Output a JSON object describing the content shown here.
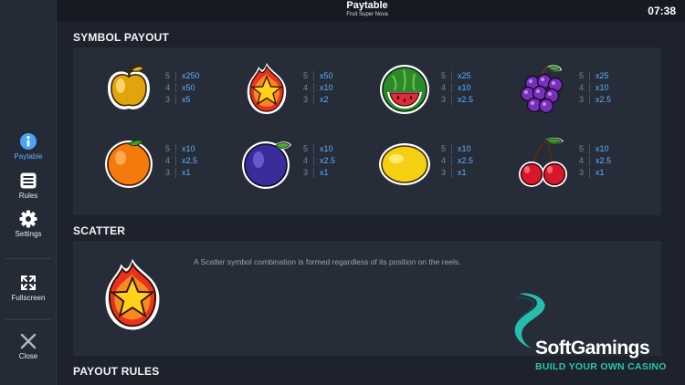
{
  "header": {
    "title": "Paytable",
    "subtitle": "Fruit Super Nova",
    "clock": "07:38"
  },
  "sidebar": {
    "items": [
      {
        "label": "Paytable",
        "icon": "info-icon",
        "active": true
      },
      {
        "label": "Rules",
        "icon": "list-icon",
        "active": false
      },
      {
        "label": "Settings",
        "icon": "gear-icon",
        "active": false
      },
      {
        "label": "Fullscreen",
        "icon": "fullscreen-icon",
        "active": false
      },
      {
        "label": "Close",
        "icon": "close-icon",
        "active": false
      }
    ]
  },
  "sections": {
    "symbol_payout": "SYMBOL PAYOUT",
    "scatter": "SCATTER",
    "payout_rules": "PAYOUT RULES"
  },
  "payouts": [
    {
      "symbol": "apple",
      "rows": [
        {
          "count": "5",
          "mult": "x250"
        },
        {
          "count": "4",
          "mult": "x50"
        },
        {
          "count": "3",
          "mult": "x5"
        }
      ]
    },
    {
      "symbol": "star",
      "rows": [
        {
          "count": "5",
          "mult": "x50"
        },
        {
          "count": "4",
          "mult": "x10"
        },
        {
          "count": "3",
          "mult": "x2"
        }
      ]
    },
    {
      "symbol": "watermelon",
      "rows": [
        {
          "count": "5",
          "mult": "x25"
        },
        {
          "count": "4",
          "mult": "x10"
        },
        {
          "count": "3",
          "mult": "x2.5"
        }
      ]
    },
    {
      "symbol": "grapes",
      "rows": [
        {
          "count": "5",
          "mult": "x25"
        },
        {
          "count": "4",
          "mult": "x10"
        },
        {
          "count": "3",
          "mult": "x2.5"
        }
      ]
    },
    {
      "symbol": "orange",
      "rows": [
        {
          "count": "5",
          "mult": "x10"
        },
        {
          "count": "4",
          "mult": "x2.5"
        },
        {
          "count": "3",
          "mult": "x1"
        }
      ]
    },
    {
      "symbol": "plum",
      "rows": [
        {
          "count": "5",
          "mult": "x10"
        },
        {
          "count": "4",
          "mult": "x2.5"
        },
        {
          "count": "3",
          "mult": "x1"
        }
      ]
    },
    {
      "symbol": "lemon",
      "rows": [
        {
          "count": "5",
          "mult": "x10"
        },
        {
          "count": "4",
          "mult": "x2.5"
        },
        {
          "count": "3",
          "mult": "x1"
        }
      ]
    },
    {
      "symbol": "cherry",
      "rows": [
        {
          "count": "5",
          "mult": "x10"
        },
        {
          "count": "4",
          "mult": "x2.5"
        },
        {
          "count": "3",
          "mult": "x1"
        }
      ]
    }
  ],
  "scatter": {
    "symbol": "star",
    "description": "A Scatter symbol combination is formed regardless of its position on the reels."
  },
  "watermark": {
    "name": "SoftGamings",
    "tagline": "BUILD YOUR OWN CASINO"
  },
  "colors": {
    "accent": "#5fb0ff",
    "background": "#1d222c",
    "panel": "#262c38",
    "sidebar": "#242a36",
    "brand_teal": "#26c6b0"
  }
}
